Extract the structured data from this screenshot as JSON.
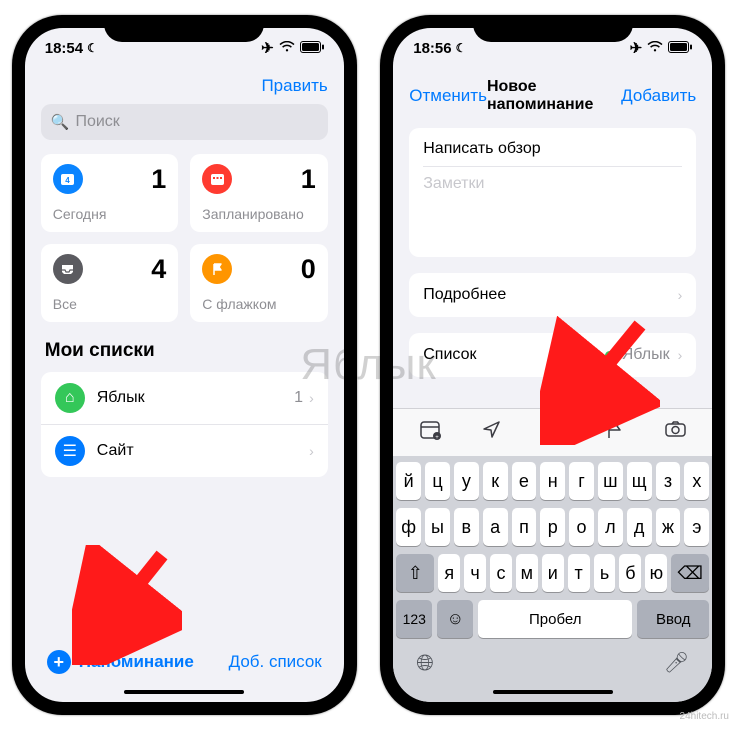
{
  "watermark": "Яблык",
  "credit": "24hitech.ru",
  "phone1": {
    "status": {
      "time": "18:54"
    },
    "edit_label": "Править",
    "search_placeholder": "Поиск",
    "cards": {
      "today": {
        "label": "Сегодня",
        "count": "1"
      },
      "scheduled": {
        "label": "Запланировано",
        "count": "1"
      },
      "all": {
        "label": "Все",
        "count": "4"
      },
      "flagged": {
        "label": "С флажком",
        "count": "0"
      }
    },
    "section_title": "Мои списки",
    "lists": [
      {
        "name": "Яблык",
        "count": "1"
      },
      {
        "name": "Сайт",
        "count": ""
      }
    ],
    "bottom": {
      "new_reminder": "Напоминание",
      "add_list": "Доб. список"
    }
  },
  "phone2": {
    "status": {
      "time": "18:56"
    },
    "nav": {
      "cancel": "Отменить",
      "title": "Новое напоминание",
      "add": "Добавить"
    },
    "form": {
      "title": "Написать обзор",
      "notes_placeholder": "Заметки"
    },
    "details_label": "Подробнее",
    "list_label": "Список",
    "list_value": "Яблык",
    "keyboard": {
      "row1": [
        "й",
        "ц",
        "у",
        "к",
        "е",
        "н",
        "г",
        "ш",
        "щ",
        "з",
        "х"
      ],
      "row2": [
        "ф",
        "ы",
        "в",
        "а",
        "п",
        "р",
        "о",
        "л",
        "д",
        "ж",
        "э"
      ],
      "row3": [
        "я",
        "ч",
        "с",
        "м",
        "и",
        "т",
        "ь",
        "б",
        "ю"
      ],
      "k123": "123",
      "space": "Пробел",
      "ret": "Ввод"
    }
  }
}
